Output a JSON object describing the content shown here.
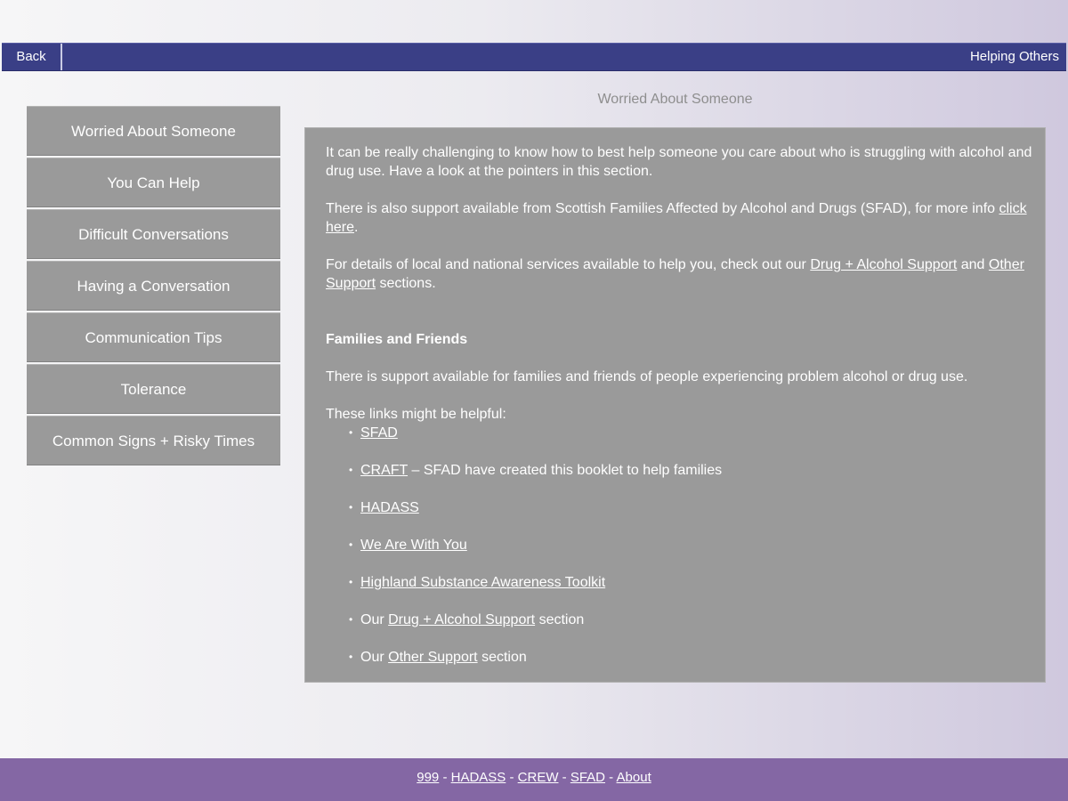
{
  "nav": {
    "back_label": "Back",
    "section_title": "Helping Others"
  },
  "sidebar": {
    "items": [
      {
        "label": "Worried About Someone"
      },
      {
        "label": "You Can Help"
      },
      {
        "label": "Difficult Conversations"
      },
      {
        "label": "Having a Conversation"
      },
      {
        "label": "Communication Tips"
      },
      {
        "label": "Tolerance"
      },
      {
        "label": "Common Signs + Risky Times"
      }
    ]
  },
  "page": {
    "title": "Worried About Someone"
  },
  "content": {
    "p1": "It can be really challenging to know how to best help someone you care about who is struggling with alcohol and drug use. Have a look at the pointers in this section.",
    "p2_before": "There is also support available from Scottish Families Affected by Alcohol and Drugs (SFAD), for more info ",
    "p2_link": "click here",
    "p2_after": ".",
    "p3_before": "For details of local and national services available to help you, check out our ",
    "p3_link1": "Drug + Alcohol Support",
    "p3_middle": " and ",
    "p3_link2": "Other Support",
    "p3_after": " sections.",
    "heading": "Families and Friends",
    "p4": "There is support available for families and friends of people experiencing problem alcohol or drug use.",
    "links_intro": "These links might be helpful:",
    "bullet": "•",
    "links": [
      {
        "link": "SFAD"
      },
      {
        "link": "CRAFT",
        "after": " – SFAD have created this booklet to help families"
      },
      {
        "link": "HADASS"
      },
      {
        "link": "We Are With You"
      },
      {
        "link": "Highland Substance Awareness Toolkit"
      },
      {
        "before": "Our ",
        "link": "Drug + Alcohol Support",
        "after": " section"
      },
      {
        "before": "Our ",
        "link": "Other Support",
        "after": " section"
      }
    ]
  },
  "footer": {
    "links": [
      "999",
      "HADASS",
      "CREW",
      "SFAD",
      "About"
    ],
    "separator": " - "
  },
  "colors": {
    "nav_bar": "#3a3f86",
    "panel": "#9a9a9a",
    "footer": "#8467a4"
  }
}
